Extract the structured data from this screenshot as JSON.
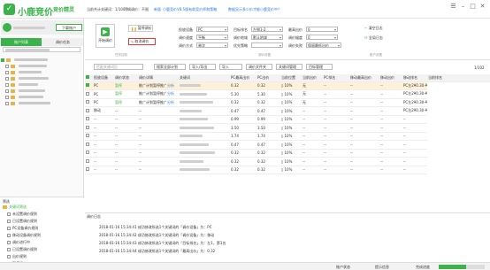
{
  "app": {
    "title": "小鹿竞价",
    "subtitle": "竞价精灵",
    "info": "当前共计关键词：1/100个",
    "status": "可调调价：不限",
    "notice_label": "新版",
    "notice": "小鹿竞价V8.5版有助竞价师和策略",
    "notice2": "数据显示多少价才能小鹿竞价中？"
  },
  "colors": {
    "brand": "#3bb34a",
    "link": "#2a7ad8",
    "highlight": "#e53935",
    "selected_row": "#fdf2d9"
  },
  "sidebar": {
    "tabs": [
      "账户列表",
      "调价任务"
    ],
    "download_label": "下载账户",
    "tree_items": [
      "用户推广",
      "",
      "",
      "",
      "",
      "",
      "",
      ""
    ],
    "bottom_title": "筛选",
    "bottom_items": [
      "关键词筛选",
      "未设置调价规则",
      "已设置调价规则",
      "PC设备调价规则",
      "移动设备调价规则",
      "调价进行中",
      "已设置调价规则",
      "出价规则",
      "暂停调价",
      "调价异常"
    ]
  },
  "toolbar": {
    "start_label": "开始调价",
    "pause_label": "暂停调价",
    "cancel_label": "取消调价",
    "group1": "任务控制",
    "device_label": "投放设备",
    "device_value": "PC",
    "speed_label": "调价速度",
    "speed_value": "平衡",
    "mode_label": "调价方式",
    "mode_value": "单次",
    "target_label": "目标排名",
    "target_value": "左侧1-2",
    "region_label": "调价地域",
    "region_value": "默认地域",
    "priority_label": "优先策略",
    "priority_value": "",
    "max_label": "最高出价",
    "max_value": "0",
    "step_label": "调价幅度",
    "step_value": "0",
    "fail_label": "调价失败",
    "fail_value": "保留最低出价",
    "group2": "调价设置",
    "clear_label": "清空日志",
    "report_label": "全局日志",
    "group3": "账户设置"
  },
  "filter": {
    "search_placeholder": "匹配关键词后",
    "filter1": "搜索全部计划",
    "filter2": "导入/导出",
    "filter3": "导入",
    "filter4": "调价文件夹",
    "filter5": "关键词管理",
    "filter6": "目标管理",
    "count": "1/102"
  },
  "table": {
    "headers": [
      "",
      "投放设备",
      "调价状态",
      "调价详情",
      "",
      "关键词",
      "PC最高出价",
      "PC出价",
      "当前位置",
      "当前出价",
      "PC排名",
      "移动最高出价",
      "移动出价",
      "移动排名",
      "当前排名"
    ],
    "rows": [
      [
        "PC",
        "暂停",
        "推广计划暂停推广",
        "分析",
        "0.32",
        "0.32",
        "10%",
        "无",
        "--",
        "--",
        "--",
        "PC左2¥0.30-¥0.35"
      ],
      [
        "PC",
        "暂停",
        "推广计划暂停推广",
        "分析",
        "5.30",
        "5.30",
        "10%",
        "无",
        "--",
        "--",
        "--",
        "PC左2¥0.30-¥0.35"
      ],
      [
        "PC",
        "暂停",
        "推广计划暂停推广",
        "分析",
        "0.32",
        "0.32",
        "10%",
        "无",
        "--",
        "--",
        "--",
        "PC左2¥0.30-¥0.35"
      ],
      [
        "移动",
        "--",
        "--",
        "",
        "0.47",
        "0.47",
        "10%",
        "--",
        "--",
        "--",
        "--",
        "PC左2¥0.30-¥0.35"
      ],
      [
        "--",
        "--",
        "--",
        "",
        "0.99",
        "0.99",
        "10%",
        "--",
        "--",
        "--",
        "--",
        "--"
      ],
      [
        "--",
        "--",
        "--",
        "",
        "3.50",
        "3.50",
        "10%",
        "--",
        "--",
        "--",
        "--",
        "--"
      ],
      [
        "--",
        "--",
        "--",
        "",
        "1.74",
        "1.74",
        "10%",
        "--",
        "--",
        "--",
        "--",
        "--"
      ],
      [
        "--",
        "--",
        "--",
        "",
        "0.47",
        "0.47",
        "10%",
        "--",
        "--",
        "--",
        "--",
        "--"
      ],
      [
        "--",
        "--",
        "--",
        "",
        "0.32",
        "0.32",
        "10%",
        "--",
        "--",
        "--",
        "--",
        "--"
      ],
      [
        "--",
        "--",
        "--",
        "",
        "0.32",
        "0.32",
        "10%",
        "--",
        "--",
        "--",
        "--",
        "--"
      ],
      [
        "--",
        "--",
        "--",
        "",
        "0.32",
        "0.32",
        "10%",
        "--",
        "--",
        "--",
        "--",
        "--"
      ]
    ]
  },
  "log": {
    "title": "调价日志",
    "lines": [
      "2018-01-16 15:34:41 成功修改所选1个关键词的「调价设备」为：PC",
      "2018-01-16 15:34:42 成功修改所选1个关键词的「调价设备」为：移动",
      "2018-01-16 15:34:43 成功修改所选1个关键词的「目标排名」为：左1，第1名",
      "2018-01-16 15:34:44 成功修改所选1个关键词的「最高出价」为：0.32"
    ]
  },
  "status": {
    "left": "账户状态",
    "mid": "提示信息",
    "progress": "完成进度",
    "right": "0%"
  }
}
